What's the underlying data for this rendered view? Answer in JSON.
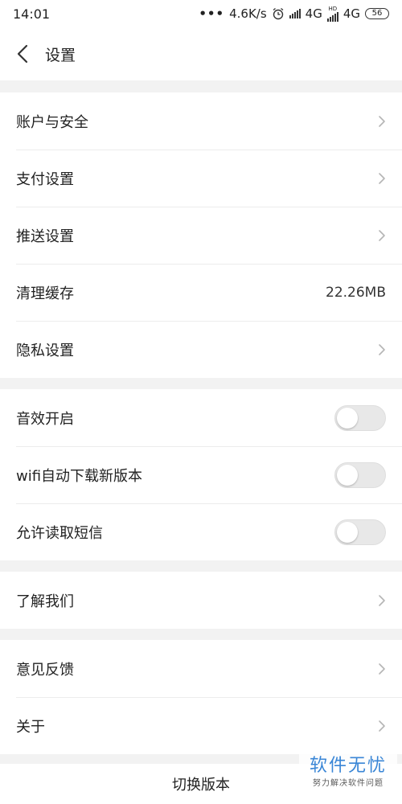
{
  "status_bar": {
    "time": "14:01",
    "dots": "•••",
    "speed": "4.6K/s",
    "network_1": "4G",
    "hd": "HD",
    "network_2": "4G",
    "battery": "56"
  },
  "header": {
    "title": "设置"
  },
  "group1": [
    {
      "label": "账户与安全"
    },
    {
      "label": "支付设置"
    },
    {
      "label": "推送设置"
    },
    {
      "label": "清理缓存",
      "value": "22.26MB"
    },
    {
      "label": "隐私设置"
    }
  ],
  "group2": [
    {
      "label": "音效开启",
      "enabled": false
    },
    {
      "label": "wifi自动下载新版本",
      "enabled": false
    },
    {
      "label": "允许读取短信",
      "enabled": false
    }
  ],
  "group3": [
    {
      "label": "了解我们"
    }
  ],
  "group4": [
    {
      "label": "意见反馈"
    },
    {
      "label": "关于"
    }
  ],
  "footer": {
    "switch_version": "切换版本"
  },
  "watermark": {
    "main": "软件无忧",
    "sub": "努力解决软件问题"
  },
  "colors": {
    "page_background": "#f2f2f2",
    "toggle_off": "#e8e8e8",
    "chevron": "#b5b5b5",
    "watermark": "#3a86d6"
  }
}
